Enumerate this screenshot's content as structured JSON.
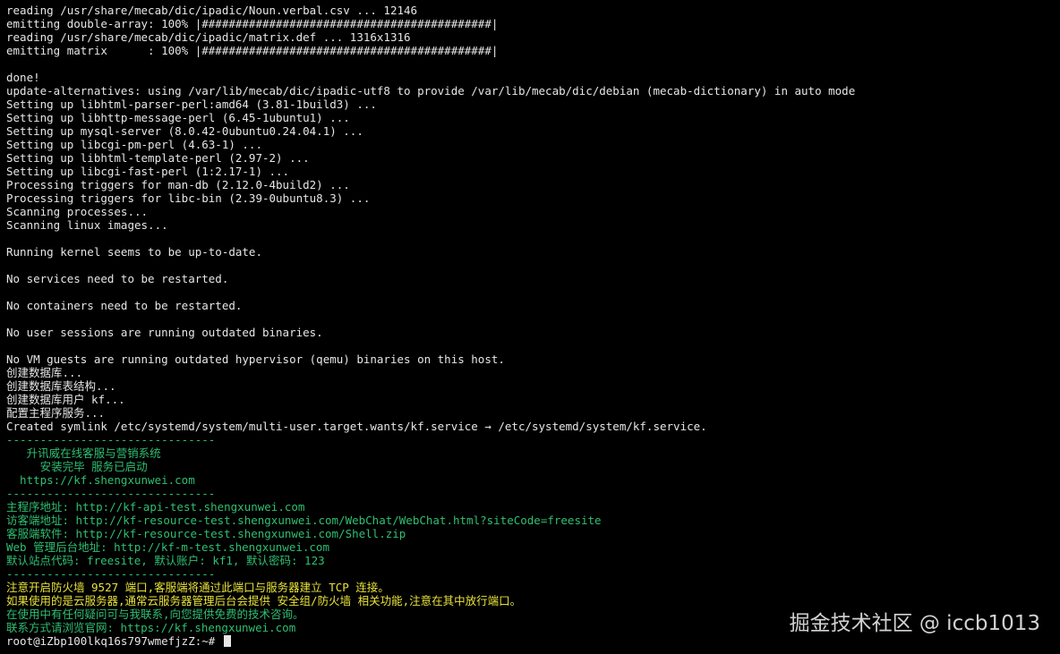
{
  "terminal": {
    "lines": [
      {
        "text": "reading /usr/share/mecab/dic/ipadic/Noun.verbal.csv ... 12146",
        "color": "white"
      },
      {
        "text": "emitting double-array: 100% |###########################################|",
        "color": "white"
      },
      {
        "text": "reading /usr/share/mecab/dic/ipadic/matrix.def ... 1316x1316",
        "color": "white"
      },
      {
        "text": "emitting matrix      : 100% |###########################################|",
        "color": "white"
      },
      {
        "text": "",
        "color": "white"
      },
      {
        "text": "done!",
        "color": "white"
      },
      {
        "text": "update-alternatives: using /var/lib/mecab/dic/ipadic-utf8 to provide /var/lib/mecab/dic/debian (mecab-dictionary) in auto mode",
        "color": "white"
      },
      {
        "text": "Setting up libhtml-parser-perl:amd64 (3.81-1build3) ...",
        "color": "white"
      },
      {
        "text": "Setting up libhttp-message-perl (6.45-1ubuntu1) ...",
        "color": "white"
      },
      {
        "text": "Setting up mysql-server (8.0.42-0ubuntu0.24.04.1) ...",
        "color": "white"
      },
      {
        "text": "Setting up libcgi-pm-perl (4.63-1) ...",
        "color": "white"
      },
      {
        "text": "Setting up libhtml-template-perl (2.97-2) ...",
        "color": "white"
      },
      {
        "text": "Setting up libcgi-fast-perl (1:2.17-1) ...",
        "color": "white"
      },
      {
        "text": "Processing triggers for man-db (2.12.0-4build2) ...",
        "color": "white"
      },
      {
        "text": "Processing triggers for libc-bin (2.39-0ubuntu8.3) ...",
        "color": "white"
      },
      {
        "text": "Scanning processes...",
        "color": "white"
      },
      {
        "text": "Scanning linux images...",
        "color": "white"
      },
      {
        "text": "",
        "color": "white"
      },
      {
        "text": "Running kernel seems to be up-to-date.",
        "color": "white"
      },
      {
        "text": "",
        "color": "white"
      },
      {
        "text": "No services need to be restarted.",
        "color": "white"
      },
      {
        "text": "",
        "color": "white"
      },
      {
        "text": "No containers need to be restarted.",
        "color": "white"
      },
      {
        "text": "",
        "color": "white"
      },
      {
        "text": "No user sessions are running outdated binaries.",
        "color": "white"
      },
      {
        "text": "",
        "color": "white"
      },
      {
        "text": "No VM guests are running outdated hypervisor (qemu) binaries on this host.",
        "color": "white"
      },
      {
        "text": "创建数据库...",
        "color": "white"
      },
      {
        "text": "创建数据库表结构...",
        "color": "white"
      },
      {
        "text": "创建数据库用户 kf...",
        "color": "white"
      },
      {
        "text": "配置主程序服务...",
        "color": "white"
      },
      {
        "text": "Created symlink /etc/systemd/system/multi-user.target.wants/kf.service → /etc/systemd/system/kf.service.",
        "color": "white"
      },
      {
        "text": "-------------------------------",
        "color": "green"
      },
      {
        "text": "   升讯威在线客服与营销系统",
        "color": "green"
      },
      {
        "text": "     安装完毕 服务已启动",
        "color": "green"
      },
      {
        "text": "  https://kf.shengxunwei.com",
        "color": "green"
      },
      {
        "text": "-------------------------------",
        "color": "green"
      },
      {
        "text": "主程序地址: http://kf-api-test.shengxunwei.com",
        "color": "green"
      },
      {
        "text": "访客端地址: http://kf-resource-test.shengxunwei.com/WebChat/WebChat.html?siteCode=freesite",
        "color": "green"
      },
      {
        "text": "客服端软件: http://kf-resource-test.shengxunwei.com/Shell.zip",
        "color": "green"
      },
      {
        "text": "Web 管理后台地址: http://kf-m-test.shengxunwei.com",
        "color": "green"
      },
      {
        "text": "默认站点代码: freesite, 默认账户: kf1, 默认密码: 123",
        "color": "green"
      },
      {
        "text": "-------------------------------",
        "color": "green"
      },
      {
        "text": "注意开启防火墙 9527 端口,客服端将通过此端口与服务器建立 TCP 连接。",
        "color": "yellow"
      },
      {
        "text": "如果使用的是云服务器,通常云服务器管理后台会提供 安全组/防火墙 相关功能,注意在其中放行端口。",
        "color": "yellow"
      },
      {
        "text": "在使用中有任何疑问可与我联系,向您提供免费的技术咨询。",
        "color": "green"
      },
      {
        "text": "联系方式请浏览官网: https://kf.shengxunwei.com",
        "color": "green"
      }
    ],
    "prompt": "root@iZbp100lkq16s797wmefjzZ:~# "
  },
  "watermark": {
    "text": "掘金技术社区 @ iccb1013"
  },
  "colors": {
    "background": "#000000",
    "text": "#e6e6e6",
    "green": "#2fbf71",
    "yellow": "#e8e23a"
  }
}
